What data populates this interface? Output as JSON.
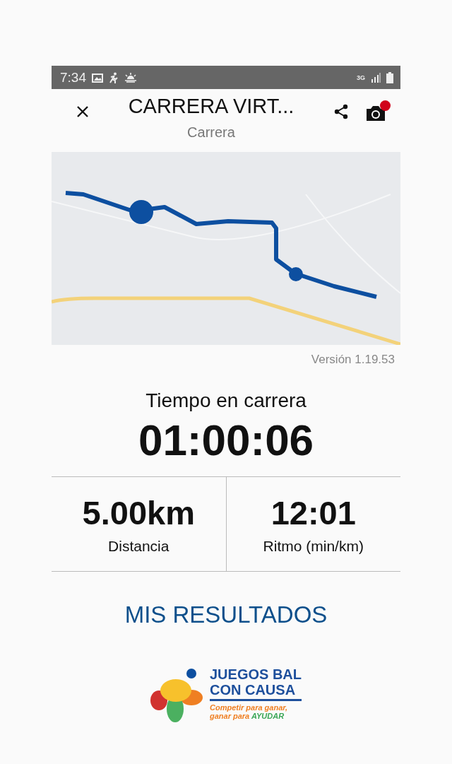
{
  "status_bar": {
    "time": "7:34",
    "network": "3G"
  },
  "header": {
    "title": "CARRERA VIRT...",
    "subtitle": "Carrera",
    "camera_badge": true
  },
  "version": "Versión 1.19.53",
  "race_time": {
    "label": "Tiempo en carrera",
    "value": "01:00:06"
  },
  "stats": [
    {
      "value": "5.00km",
      "label": "Distancia"
    },
    {
      "value": "12:01",
      "label": "Ritmo (min/km)"
    }
  ],
  "results_link": "MIS RESULTADOS",
  "logo": {
    "name_lines": [
      "JUEGOS BAL",
      "CON CAUSA"
    ],
    "tagline_lines": [
      "Competir para ganar,",
      "ganar para"
    ],
    "tagline_emphasis": "AYUDAR"
  }
}
